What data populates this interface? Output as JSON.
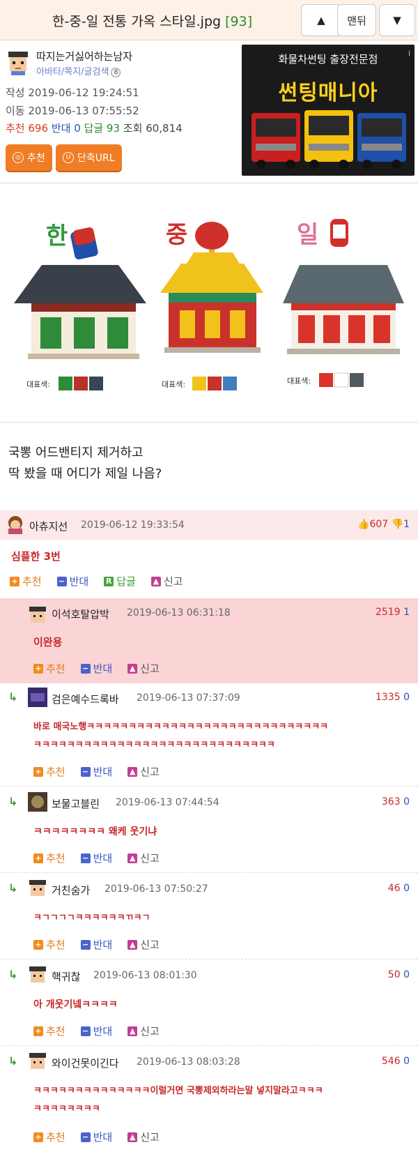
{
  "header": {
    "title": "한-중-일 전통 가옥 스타일.jpg",
    "count": "[93]",
    "up_label": "▲",
    "top_label": "맨뒤",
    "down_label": "▼"
  },
  "author": {
    "name": "따지는거싫어하는남자",
    "links": "아바타/쪽지/글검색",
    "badge": "8"
  },
  "meta": {
    "written": "작성 2019-06-12 19:24:51",
    "moved": "이동 2019-06-13 07:55:52"
  },
  "stats": {
    "rec_label": "추천",
    "rec": "696",
    "opp_label": "반대",
    "opp": "0",
    "reply_label": "답글",
    "reply": "93",
    "view_label": "조회",
    "view": "60,814"
  },
  "buttons": {
    "recommend": "추천",
    "short_url": "단축URL"
  },
  "ad": {
    "line1": "화물차썬팅 출장전문점",
    "line2": "썬팅매니아",
    "info": "i"
  },
  "illustration": {
    "korea": "한",
    "china": "중",
    "japan": "일",
    "legend": "대표색:",
    "korea_colors": [
      "#2e8b3a",
      "#b8322a",
      "#3a4553"
    ],
    "china_colors": [
      "#f2c21c",
      "#c8322a",
      "#3f7fc1"
    ],
    "japan_colors": [
      "#d8342a",
      "#ffffff",
      "#4f5b60"
    ]
  },
  "body": {
    "line1": "국뽕 어드밴티지 제거하고",
    "line2": "딱 봤을 때 어디가 제일 나음?"
  },
  "actions": {
    "recommend": "추천",
    "oppose": "반대",
    "reply": "답글",
    "report": "신고"
  },
  "comments": [
    {
      "name": "아츄지선",
      "date": "2019-06-12 19:33:54",
      "up": "607",
      "down": "1",
      "text": "심플한 3번"
    },
    {
      "name": "이석호탈압박",
      "date": "2019-06-13 06:31:18",
      "up": "2519",
      "down": "1",
      "text": "이완용"
    },
    {
      "name": "검은예수드록바",
      "date": "2019-06-13 07:37:09",
      "up": "1335",
      "down": "0",
      "text1": "바로 매국노행ㅋㅋㅋㅋㅋㅋㅋㅋㅋㅋㅋㅋㅋㅋㅋㅋㅋㅋㅋㅋㅋㅋㅋㅋㅋㅋㅋㅋㅋ",
      "text2": "ㅋㅋㅋㅋㅋㅋㅋㅋㅋㅋㅋㅋㅋㅋㅋㅋㅋㅋㅋㅋㅋㅋㅋㅋㅋㅋㅋㅋㅋ"
    },
    {
      "name": "보물고블린",
      "date": "2019-06-13 07:44:54",
      "up": "363",
      "down": "0",
      "text": "ㅋㅋㅋㅋㅋㅋㅋㅋ 왜케 웃기냐"
    },
    {
      "name": "거친숨가",
      "date": "2019-06-13 07:50:27",
      "up": "46",
      "down": "0",
      "text": "ㅋㄱㄱㄱㄱㅋㅋㅋㅋㅋㅋㄲㅋㄱ"
    },
    {
      "name": "핵귀찮",
      "date": "2019-06-13 08:01:30",
      "up": "50",
      "down": "0",
      "text": "아 개웃기넼ㅋㅋㅋㅋ"
    },
    {
      "name": "와이건못이긴다",
      "date": "2019-06-13 08:03:28",
      "up": "546",
      "down": "0",
      "text1": "ㅋㅋㅋㅋㅋㅋㅋㅋㅋㅋㅋㅋㅋㅋ이럴거면 국뽕제외하라는말 넣지말라고ㅋㅋㅋ",
      "text2": "ㅋㅋㅋㅋㅋㅋㅋㅋ"
    }
  ]
}
